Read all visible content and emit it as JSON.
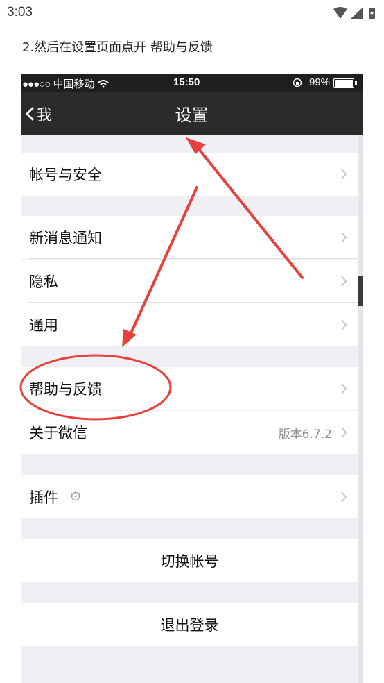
{
  "android_status": {
    "time": "3:03"
  },
  "instruction": "2.然后在设置页面点开 帮助与反馈",
  "screenshot": {
    "ios_status": {
      "carrier": "中国移动",
      "signal_dots": "●●●○○",
      "time": "15:50",
      "battery": "99%"
    },
    "navbar": {
      "back_label": "我",
      "title": "设置"
    },
    "sections": [
      {
        "items": [
          {
            "label": "帐号与安全"
          }
        ]
      },
      {
        "items": [
          {
            "label": "新消息通知"
          },
          {
            "label": "隐私"
          },
          {
            "label": "通用"
          }
        ]
      },
      {
        "items": [
          {
            "label": "帮助与反馈"
          },
          {
            "label": "关于微信",
            "value": "版本6.7.2"
          }
        ]
      },
      {
        "items": [
          {
            "label": "插件"
          }
        ]
      },
      {
        "items": [
          {
            "label": "切换帐号"
          }
        ]
      },
      {
        "items": [
          {
            "label": "退出登录"
          }
        ]
      }
    ]
  },
  "colors": {
    "annotation_red": "#e8413c",
    "navbar_bg": "#2b2b2b",
    "group_bg": "#efeff4"
  }
}
